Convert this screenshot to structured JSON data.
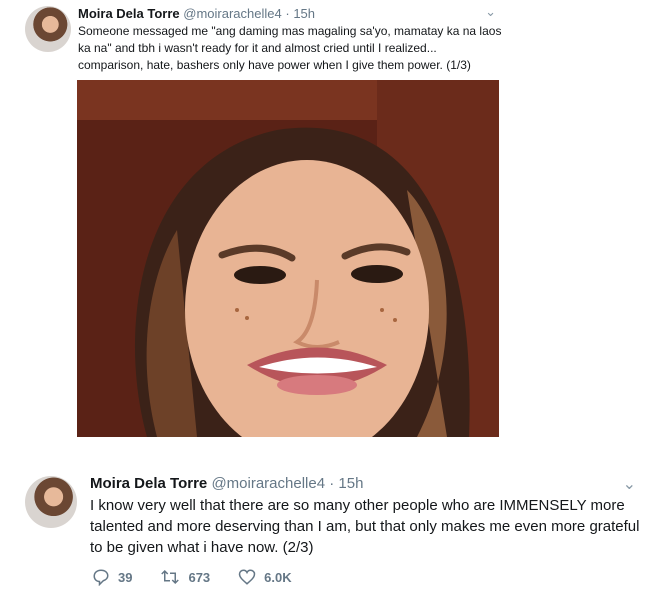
{
  "tweets": [
    {
      "name": "Moira Dela Torre",
      "handle": "@moirarachelle4",
      "dot": "·",
      "time": "15h",
      "text": "Someone messaged me \"ang daming mas magaling sa'yo, mamatay ka na laos ka na\" and tbh i wasn't ready for it and almost cried until I realized... comparison, hate, bashers only have power when I give them power. (1/3)"
    },
    {
      "name": "Moira Dela Torre",
      "handle": "@moirarachelle4",
      "dot": "·",
      "time": "15h",
      "text": "I know very well that there are so many other people who are IMMENSELY more talented and more deserving than I am, but that only makes me even more grateful to be given what i have now. (2/3)",
      "actions": {
        "replies": "39",
        "retweets": "673",
        "likes": "6.0K"
      }
    }
  ],
  "icons": {
    "chevron": "chevron-down-icon",
    "reply": "reply-icon",
    "retweet": "retweet-icon",
    "like": "heart-icon"
  },
  "colors": {
    "text": "#14171a",
    "muted": "#657786"
  }
}
